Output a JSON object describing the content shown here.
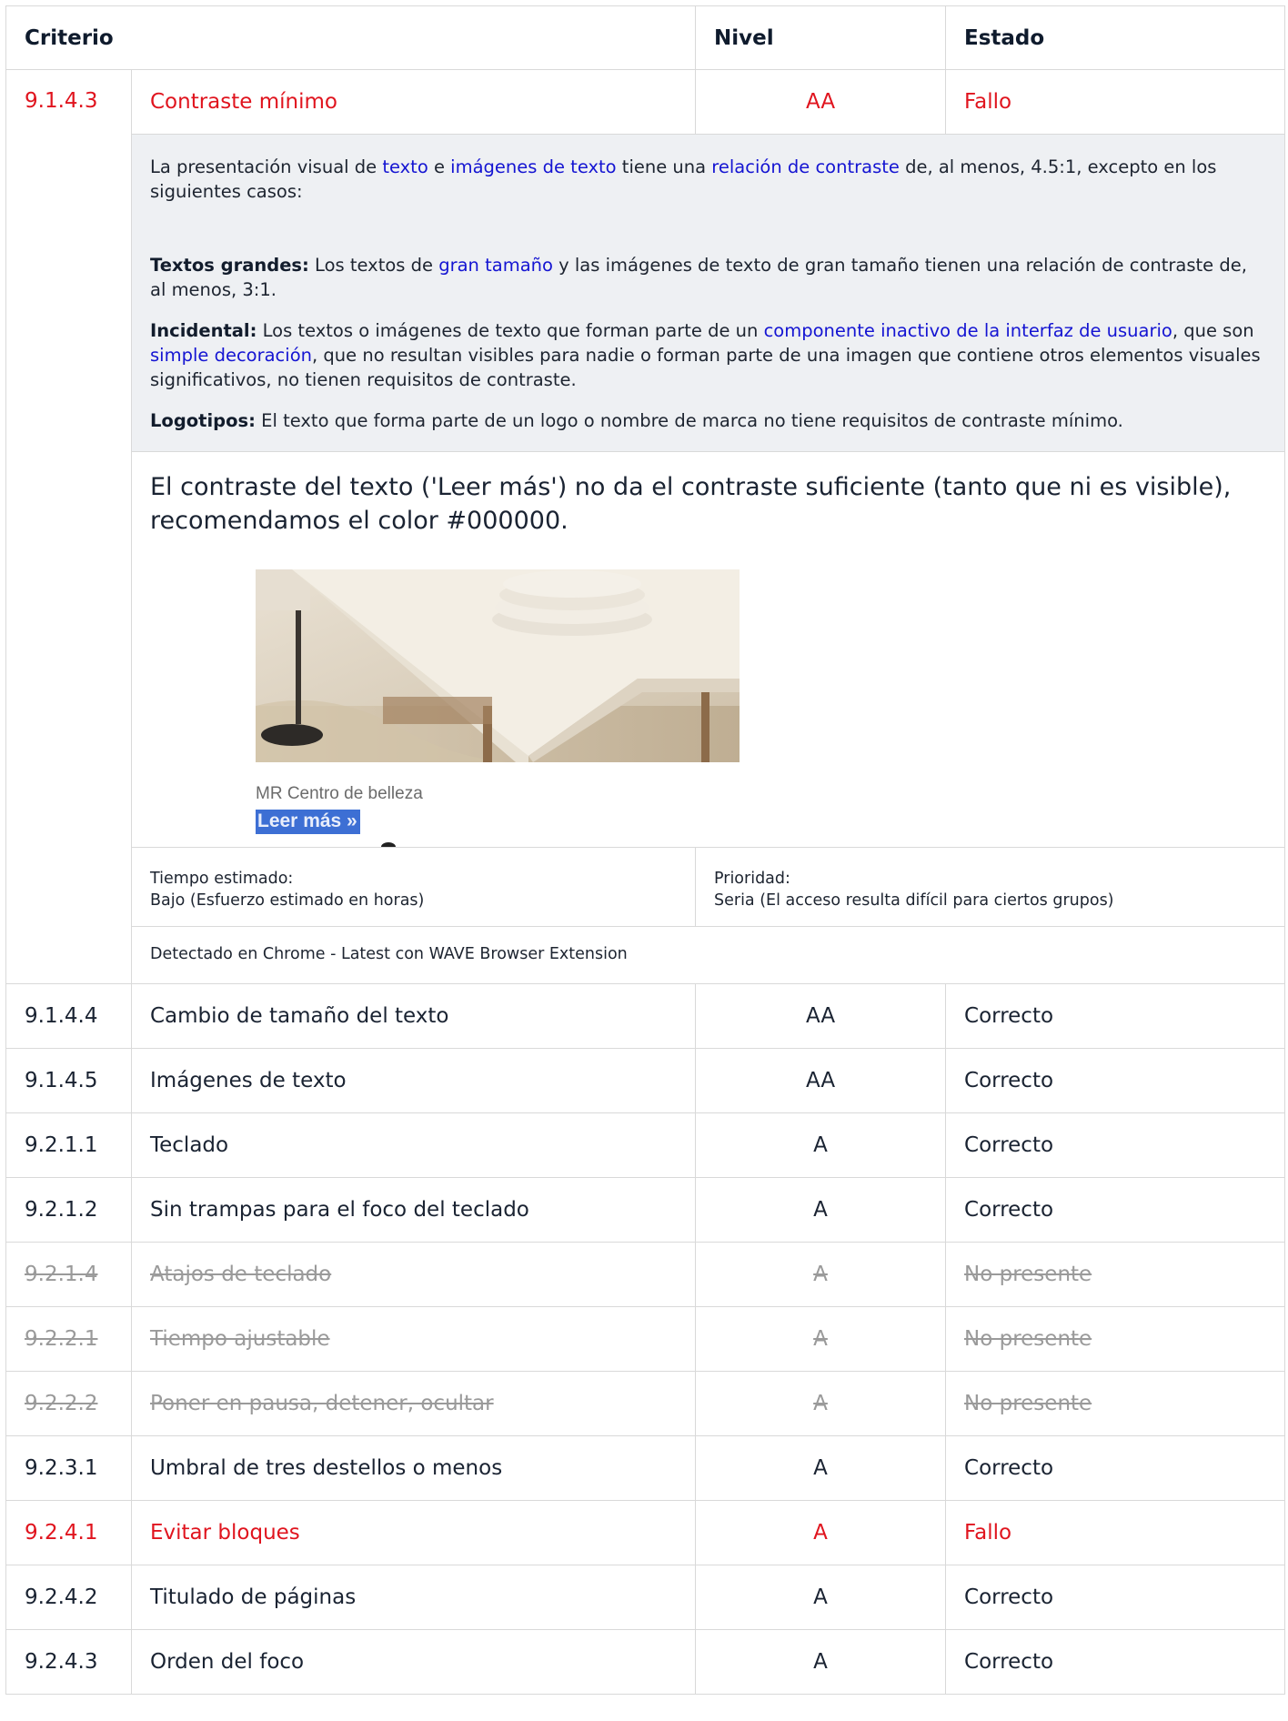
{
  "headers": {
    "criterion": "Criterio",
    "level": "Nivel",
    "status": "Estado"
  },
  "failed_item": {
    "id": "9.1.4.3",
    "title": "Contraste mínimo",
    "level": "AA",
    "status": "Fallo",
    "requirement": {
      "p1_a": "La presentación visual de ",
      "p1_link1": "texto",
      "p1_b": " e ",
      "p1_link2": "imágenes de texto",
      "p1_c": " tiene una ",
      "p1_link3": "relación de contraste",
      "p1_d": " de, al menos, 4.5:1, excepto en los siguientes casos:",
      "p2_label": "Textos grandes:",
      "p2_a": " Los textos de ",
      "p2_link": "gran tamaño",
      "p2_b": " y las imágenes de texto de gran tamaño tienen una relación de contraste de, al menos, 3:1.",
      "p3_label": "Incidental:",
      "p3_a": " Los textos o imágenes de texto que forman parte de un ",
      "p3_link1": "componente inactivo de la interfaz de usuario",
      "p3_b": ", que son ",
      "p3_link2": "simple decoración",
      "p3_c": ", que no resultan visibles para nadie o forman parte de una imagen que contiene otros elementos visuales significativos, no tienen requisitos de contraste.",
      "p4_label": "Logotipos:",
      "p4_a": " El texto que forma parte de un logo o nombre de marca no tiene requisitos de contraste mínimo."
    },
    "finding": "El contraste del texto ('Leer más') no da el contraste suficiente (tanto que ni es visible), recomendamos el color #000000.",
    "screenshot": {
      "brand": "MR Centro de belleza",
      "readmore": "Leer más »"
    },
    "time_label": "Tiempo estimado:",
    "time_value": "Bajo (Esfuerzo estimado en horas)",
    "priority_label": "Prioridad:",
    "priority_value": "Seria (El acceso resulta difícil para ciertos grupos)",
    "detected": "Detectado en Chrome - Latest con WAVE Browser Extension"
  },
  "rows": [
    {
      "id": "9.1.4.4",
      "title": "Cambio de tamaño del texto",
      "level": "AA",
      "status": "Correcto"
    },
    {
      "id": "9.1.4.5",
      "title": "Imágenes de texto",
      "level": "AA",
      "status": "Correcto"
    },
    {
      "id": "9.2.1.1",
      "title": "Teclado",
      "level": "A",
      "status": "Correcto"
    },
    {
      "id": "9.2.1.2",
      "title": "Sin trampas para el foco del teclado",
      "level": "A",
      "status": "Correcto"
    },
    {
      "id": "9.2.1.4",
      "title": "Atajos de teclado",
      "level": "A",
      "status": "No presente"
    },
    {
      "id": "9.2.2.1",
      "title": "Tiempo ajustable",
      "level": "A",
      "status": "No presente"
    },
    {
      "id": "9.2.2.2",
      "title": "Poner en pausa, detener, ocultar",
      "level": "A",
      "status": "No presente"
    },
    {
      "id": "9.2.3.1",
      "title": "Umbral de tres destellos o menos",
      "level": "A",
      "status": "Correcto"
    },
    {
      "id": "9.2.4.1",
      "title": "Evitar bloques",
      "level": "A",
      "status": "Fallo"
    },
    {
      "id": "9.2.4.2",
      "title": "Titulado de páginas",
      "level": "A",
      "status": "Correcto"
    },
    {
      "id": "9.2.4.3",
      "title": "Orden del foco",
      "level": "A",
      "status": "Correcto"
    }
  ],
  "colors": {
    "fail": "#e0141e",
    "absent": "#9a9a9a",
    "link": "#1414d2",
    "detail_bg": "#eef0f3"
  }
}
